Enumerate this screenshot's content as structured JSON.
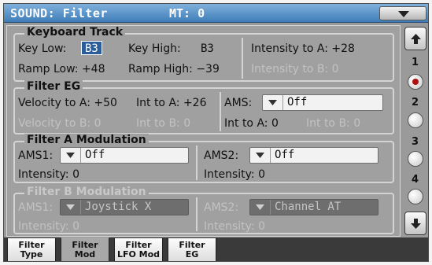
{
  "header": {
    "title": "SOUND: Filter",
    "mt": "MT: 0"
  },
  "keyboard_track": {
    "title": "Keyboard Track",
    "key_low_label": "Key Low:",
    "key_low_value": "B3",
    "key_high_label": "Key High:",
    "key_high_value": "B3",
    "intensity_a": "Intensity to A: +28",
    "ramp_low": "Ramp Low: +48",
    "ramp_high": "Ramp High: −39",
    "intensity_b": "Intensity to B: 0"
  },
  "filter_eg": {
    "title": "Filter EG",
    "velocity_a": "Velocity to A: +50",
    "int_a": "Int to A: +26",
    "ams_label": "AMS:",
    "ams_value": "Off",
    "velocity_b": "Velocity to B: 0",
    "int_b": "Int to B: 0",
    "ams_int_a": "Int to A: 0",
    "ams_int_b": "Int to B: 0"
  },
  "filter_a_mod": {
    "title": "Filter A Modulation",
    "ams1_label": "AMS1:",
    "ams1_value": "Off",
    "ams2_label": "AMS2:",
    "ams2_value": "Off",
    "intensity1": "Intensity: 0",
    "intensity2": "Intensity: 0"
  },
  "filter_b_mod": {
    "title": "Filter B Modulation",
    "ams1_label": "AMS1:",
    "ams1_value": "Joystick X",
    "ams2_label": "AMS2:",
    "ams2_value": "Channel AT",
    "intensity1": "Intensity: 0",
    "intensity2": "Intensity: 0"
  },
  "scroll": {
    "numbers": [
      "1",
      "2",
      "3",
      "4"
    ],
    "selected": 1
  },
  "tabs": [
    {
      "line1": "Filter",
      "line2": "Type",
      "active": false
    },
    {
      "line1": "Filter",
      "line2": "Mod",
      "active": true
    },
    {
      "line1": "Filter",
      "line2": "LFO Mod",
      "active": false
    },
    {
      "line1": "Filter",
      "line2": "EG",
      "active": false
    }
  ],
  "colors": {
    "titlebar": "#3f7db8",
    "selected_value": "#2a5d9a",
    "radio_selected": "#b01010"
  }
}
